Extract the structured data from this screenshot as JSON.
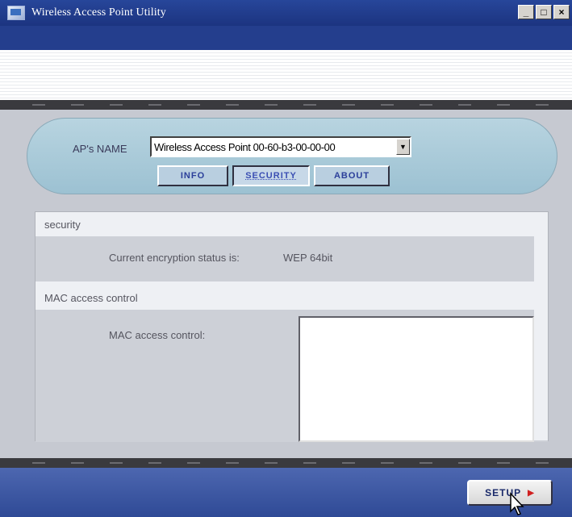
{
  "window": {
    "title": "Wireless Access Point Utility",
    "buttons": {
      "minimize": "_",
      "maximize": "□",
      "close": "×"
    }
  },
  "selector": {
    "label": "AP's NAME",
    "selected_value": "Wireless Access Point 00-60-b3-00-00-00",
    "dropdown_icon": "▼"
  },
  "tabs": [
    {
      "label": "INFO",
      "active": false
    },
    {
      "label": "SECURITY",
      "active": true
    },
    {
      "label": "ABOUT",
      "active": false
    }
  ],
  "security": {
    "heading": "security",
    "status_label": "Current encryption status is:",
    "status_value": "WEP 64bit"
  },
  "mac": {
    "heading": "MAC access control",
    "field_label": "MAC access control:"
  },
  "footer": {
    "setup_label": "SETUP",
    "setup_arrow": "▶"
  },
  "colors": {
    "titlebar": "#1c3480",
    "accent_pill": "#9cc1d2",
    "tab_text": "#2b3f9a",
    "footer": "#2f4a96"
  }
}
